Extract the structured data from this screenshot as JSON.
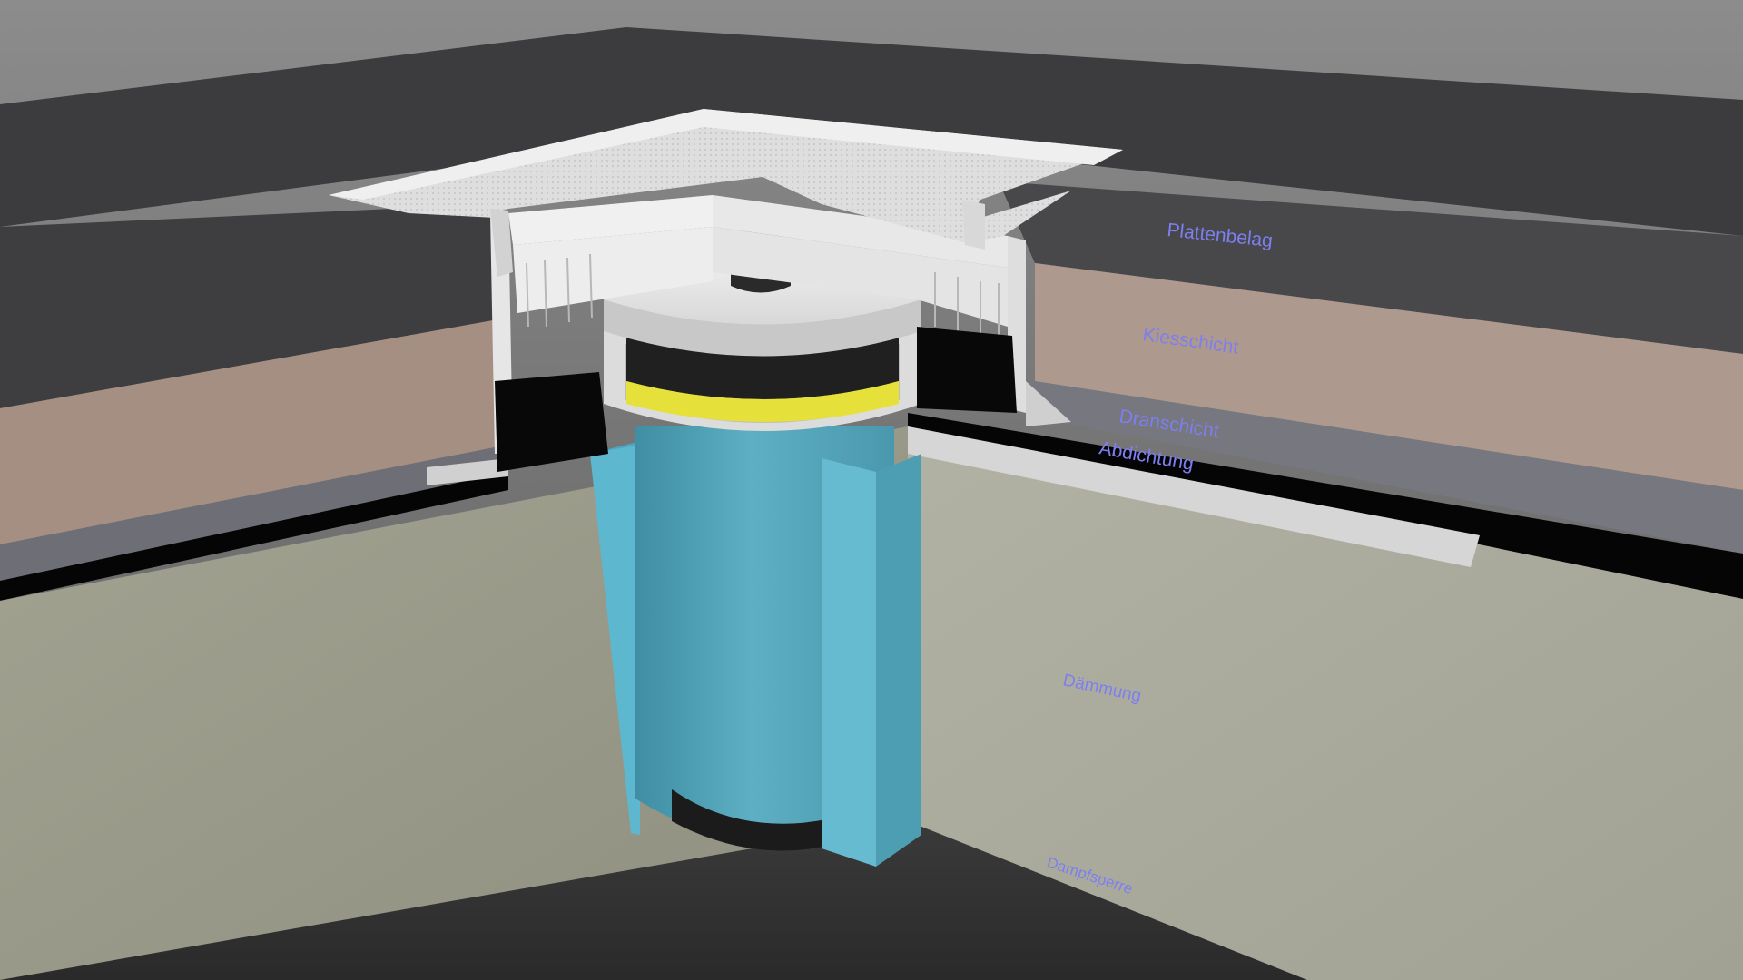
{
  "diagram": {
    "labels": {
      "plattenbelag": "Plattenbelag",
      "kiesschicht": "Kiesschicht",
      "dranschicht": "Dranschicht",
      "abdichtung": "Abdichtung",
      "daemmung": "Dämmung",
      "dampfsperre": "Dampfsperre"
    },
    "colors": {
      "background_top": "#8a8a8a",
      "paving": "#424244",
      "gravel": "#a89487",
      "drainage": "#74747c",
      "waterproofing": "#050505",
      "insulation": "#a8a89a",
      "drain_body": "#5aaabf",
      "drain_fin": "#68bbd0",
      "seal_ring": "#e8e23a",
      "grate": "#dcdcdc",
      "label_text": "#7d7ff0"
    }
  }
}
